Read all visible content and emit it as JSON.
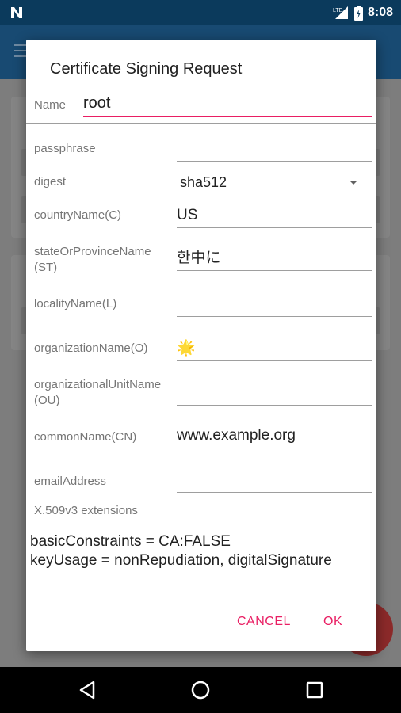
{
  "status_bar": {
    "time": "8:08",
    "network": "LTE",
    "icons": [
      "notification-n-icon",
      "lte-signal-icon",
      "battery-charging-icon"
    ]
  },
  "dialog": {
    "title": "Certificate Signing Request",
    "name_label": "Name",
    "name_value": "root",
    "fields": [
      {
        "label": "passphrase",
        "value": ""
      },
      {
        "label": "digest",
        "value": "sha512",
        "type": "dropdown"
      },
      {
        "label": "countryName(C)",
        "value": "US"
      },
      {
        "label": "stateOrProvinceName (ST)",
        "value": "한中に"
      },
      {
        "label": "localityName(L)",
        "value": ""
      },
      {
        "label": "organizationName(O)",
        "value": "🌟"
      },
      {
        "label": "organizationalUnitName(OU)",
        "value": ""
      },
      {
        "label": "commonName(CN)",
        "value": "www.example.org"
      },
      {
        "label": "emailAddress",
        "value": ""
      }
    ],
    "extensions_label": "X.509v3 extensions",
    "extensions_value": "basicConstraints = CA:FALSE\nkeyUsage = nonRepudiation, digitalSignature",
    "cancel_label": "CANCEL",
    "ok_label": "OK"
  },
  "colors": {
    "accent": "#e91e63",
    "status_bar": "#0b3a5c",
    "app_bar": "#184a72"
  }
}
